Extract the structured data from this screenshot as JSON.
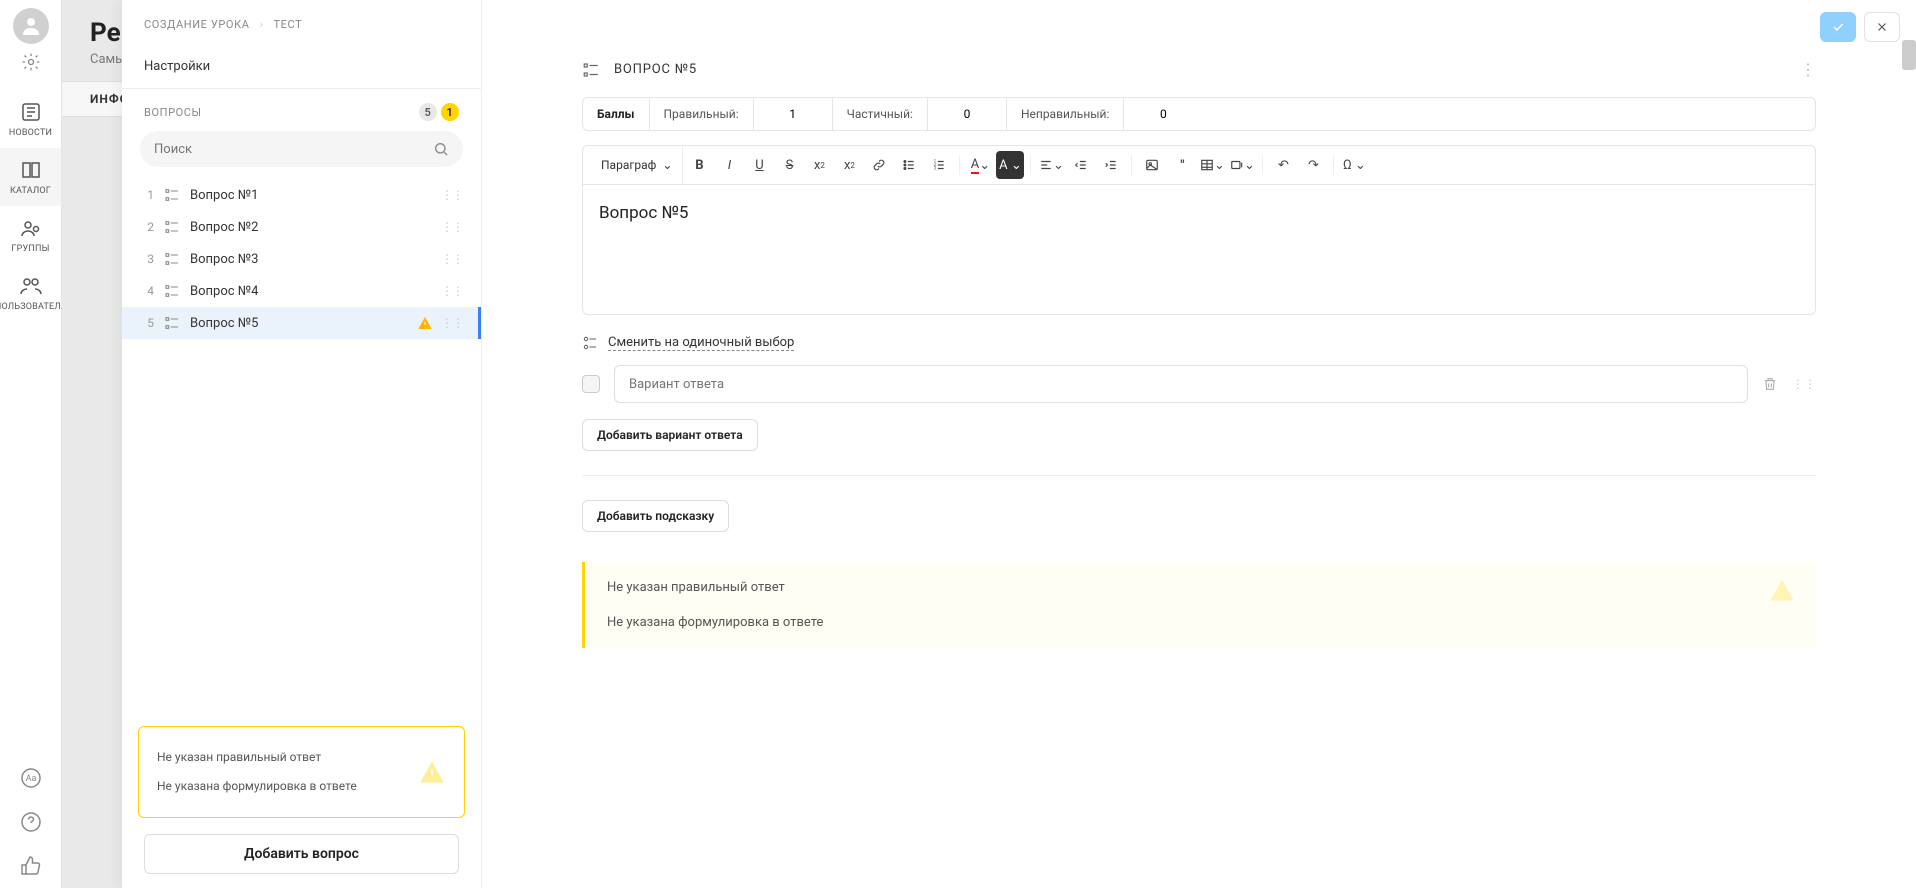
{
  "leftRail": {
    "items": [
      {
        "label": "НОВОСТИ",
        "name": "nav-news"
      },
      {
        "label": "КАТАЛОГ",
        "name": "nav-catalog",
        "active": true
      },
      {
        "label": "ГРУППЫ",
        "name": "nav-groups"
      },
      {
        "label": "ПОЛЬЗОВАТЕЛ..",
        "name": "nav-users"
      }
    ]
  },
  "bgPage": {
    "title": "Ре",
    "subtitle": "Самы",
    "tab": "ИНФО"
  },
  "breadcrumb": {
    "a": "СОЗДАНИЕ УРОКА",
    "b": "ТЕСТ"
  },
  "leftPanel": {
    "settings": "Настройки",
    "questionsHdr": "ВОПРОСЫ",
    "count": "5",
    "warnCount": "1",
    "searchPlaceholder": "Поиск",
    "items": [
      {
        "n": "1",
        "label": "Вопрос №1"
      },
      {
        "n": "2",
        "label": "Вопрос №2"
      },
      {
        "n": "3",
        "label": "Вопрос №3"
      },
      {
        "n": "4",
        "label": "Вопрос №4"
      },
      {
        "n": "5",
        "label": "Вопрос №5",
        "warn": true,
        "active": true
      }
    ],
    "warnings": [
      "Не указан правильный ответ",
      "Не указана формулировка в ответе"
    ],
    "addBtn": "Добавить вопрос"
  },
  "editor": {
    "questionTitle": "ВОПРОС №5",
    "scores": {
      "labelPoints": "Баллы",
      "labelCorrect": "Правильный:",
      "correct": "1",
      "labelPartial": "Частичный:",
      "partial": "0",
      "labelWrong": "Неправильный:",
      "wrong": "0"
    },
    "paragraph": "Параграф",
    "bodyText": "Вопрос №5",
    "switchType": "Сменить на одиночный выбор",
    "answerPlaceholder": "Вариант ответа",
    "addAnswer": "Добавить вариант ответа",
    "addHint": "Добавить подсказку",
    "warnings": [
      "Не указан правильный ответ",
      "Не указана формулировка в ответе"
    ]
  }
}
